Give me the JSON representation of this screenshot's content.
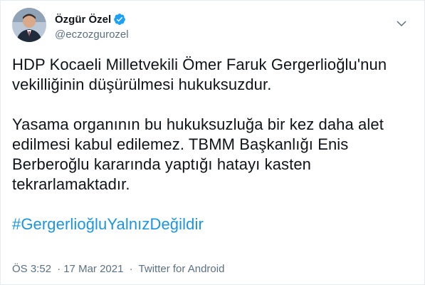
{
  "author": {
    "display_name": "Özgür Özel",
    "handle": "@eczozgurozel"
  },
  "tweet": {
    "paragraph_1": "HDP Kocaeli Milletvekili Ömer Faruk Gergerlioğlu'nun vekilliğinin düşürülmesi hukuksuzdur.",
    "paragraph_2": "Yasama organının bu hukuksuzluğa bir kez daha alet edilmesi kabul edilemez. TBMM Başkanlığı Enis Berberoğlu kararında yaptığı hatayı kasten tekrarlamaktadır.",
    "hashtag": "#GergerlioğluYalnızDeğildir"
  },
  "meta": {
    "time": "ÖS 3:52",
    "separator": "·",
    "date": "17 Mar 2021",
    "source": "Twitter for Android"
  },
  "colors": {
    "link": "#1b95e0",
    "verified": "#1da1f2",
    "secondary_text": "#5b7083"
  },
  "icons": {
    "verified": "verified-badge-icon",
    "more": "chevron-down-icon"
  }
}
